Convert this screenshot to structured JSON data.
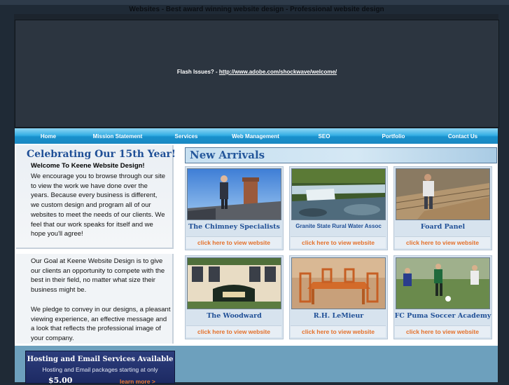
{
  "page": {
    "title": "Websites - Best award winning website design - Professional website design"
  },
  "flash": {
    "label": "Flash Issues? - ",
    "link": "http://www.adobe.com/shockwave/welcome/"
  },
  "nav": {
    "items": [
      "Home",
      "Mission Statement",
      "Services",
      "Web Management",
      "SEO",
      "Portfolio",
      "Contact Us"
    ]
  },
  "left": {
    "heading": "Celebrating Our 15th Year!",
    "welcome_title": "Welcome To Keene Website Design!",
    "welcome_text": "We encourage you to browse through our site to view the work we have done over the years. Because every business is different, we custom design and program all of our websites to meet the needs of our clients. We feel that our work speaks for itself and we hope you'll agree!",
    "goal_text": "Our Goal at Keene Website Design is to give our clients an opportunity to compete with the best in their field, no matter what size their business might be.",
    "pledge_text": "We pledge to convey in our designs, a pleasant viewing experience, an effective message and a look that reflects the professional image of your company."
  },
  "hosting": {
    "title": "Hosting and Email Services Available",
    "subtitle": "Hosting and Email packages starting at only",
    "price": "$5.00",
    "more": "learn more >"
  },
  "arrivals": {
    "title": "New Arrivals",
    "view_label": "click here to view website",
    "items": [
      {
        "name": "The Chimney Specialists",
        "photo": "chimney-photo"
      },
      {
        "name": "Granite State Rural Water Assoc",
        "photo": "waterfall-photo"
      },
      {
        "name": "Foard Panel",
        "photo": "roof-panel-photo"
      },
      {
        "name": "The Woodward",
        "photo": "woodward-building-photo"
      },
      {
        "name": "R.H. LeMieur",
        "photo": "furniture-photo"
      },
      {
        "name": "FC Puma Soccer Academy",
        "photo": "soccer-photo"
      }
    ]
  },
  "colors": {
    "background": "#1f2a36",
    "nav": "#1890cc",
    "heading_blue": "#1f4f96",
    "view_orange": "#e4702a"
  }
}
